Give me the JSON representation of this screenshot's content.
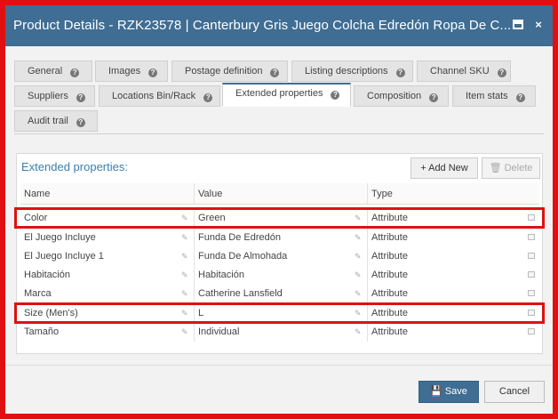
{
  "window": {
    "title": "Product Details - RZK23578 | Canterbury Gris Juego Colcha Edredón Ropa De C...",
    "close_glyph": "×"
  },
  "tabs": [
    {
      "label": "General",
      "active": false
    },
    {
      "label": "Images",
      "active": false
    },
    {
      "label": "Postage definition",
      "active": false
    },
    {
      "label": "Listing descriptions",
      "active": false
    },
    {
      "label": "Channel SKU",
      "active": false
    },
    {
      "label": "Suppliers",
      "active": false
    },
    {
      "label": "Locations Bin/Rack",
      "active": false
    },
    {
      "label": "Extended properties",
      "active": true
    },
    {
      "label": "Composition",
      "active": false
    },
    {
      "label": "Item stats",
      "active": false
    },
    {
      "label": "Audit trail",
      "active": false
    }
  ],
  "help_glyph": "?",
  "panel": {
    "title": "Extended properties:",
    "add_label": "+ Add New",
    "delete_label": "🗑 Delete"
  },
  "grid": {
    "headers": [
      "Name",
      "Value",
      "Type"
    ],
    "rows": [
      {
        "name": "Color",
        "value": "Green",
        "type": "Attribute",
        "highlighted": true
      },
      {
        "name": "El Juego Incluye",
        "value": "Funda De Edredón",
        "type": "Attribute",
        "highlighted": false
      },
      {
        "name": "El Juego Incluye 1",
        "value": "Funda De Almohada",
        "type": "Attribute",
        "highlighted": false
      },
      {
        "name": "Habitación",
        "value": "Habitación",
        "type": "Attribute",
        "highlighted": false
      },
      {
        "name": "Marca",
        "value": "Catherine Lansfield",
        "type": "Attribute",
        "highlighted": false
      },
      {
        "name": "Size (Men's)",
        "value": "L",
        "type": "Attribute",
        "highlighted": true
      },
      {
        "name": "Tamaño",
        "value": "Individual",
        "type": "Attribute",
        "highlighted": false
      }
    ],
    "edit_glyph": "✎"
  },
  "footer": {
    "save_label": "💾 Save",
    "cancel_label": "Cancel"
  },
  "colors": {
    "titlebar": "#3f6d93",
    "highlight": "#e01010",
    "panel_title": "#3a7fb0"
  }
}
